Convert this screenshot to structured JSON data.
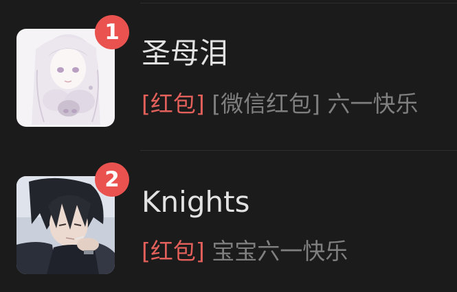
{
  "colors": {
    "background": "#1b1b1b",
    "badge": "#e9524f",
    "tag": "#e3605b",
    "name": "#e2e2e2",
    "preview": "#7f7f7f"
  },
  "chats": [
    {
      "name": "圣母泪",
      "unread": "1",
      "preview_tag": "[红包]",
      "preview_text": " [微信红包] 六一快乐",
      "avatar_icon": "anime-girl-avatar"
    },
    {
      "name": "Knights",
      "unread": "2",
      "preview_tag": "[红包]",
      "preview_text": " 宝宝六一快乐",
      "avatar_icon": "anime-boy-avatar"
    }
  ]
}
